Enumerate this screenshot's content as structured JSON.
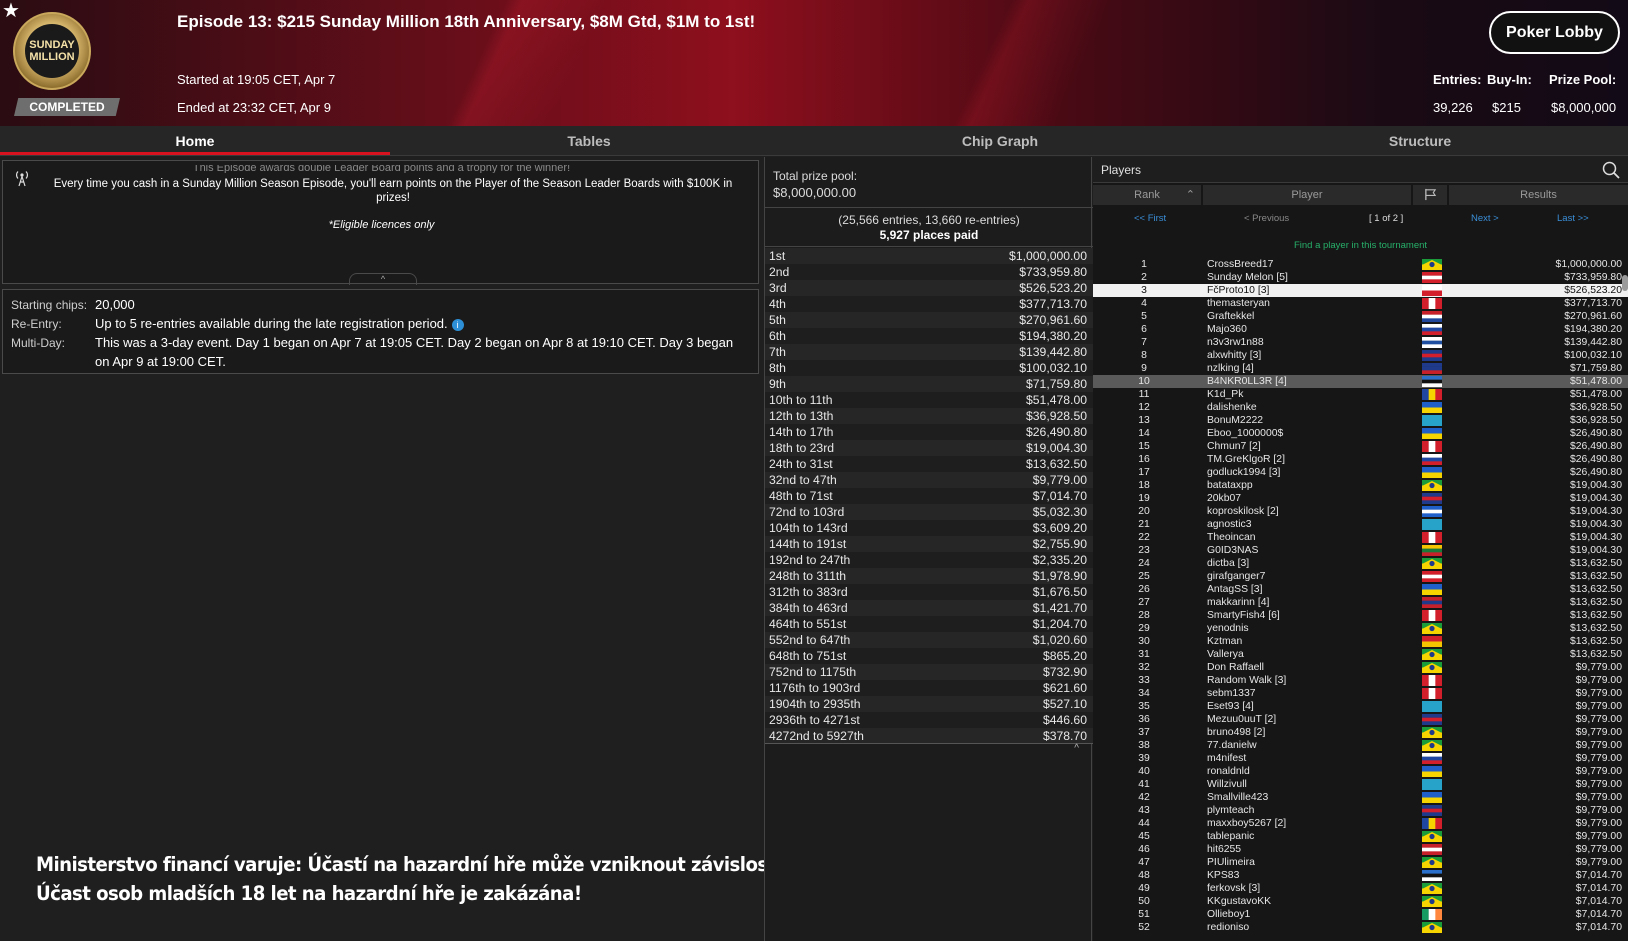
{
  "header": {
    "title": "Episode 13: $215 Sunday Million 18th Anniversary, $8M Gtd, $1M to 1st!",
    "started": "Started at 19:05 CET, Apr 7",
    "ended": "Ended at 23:32 CET, Apr 9",
    "status": "COMPLETED",
    "lobby_button": "Poker Lobby",
    "logo_text": "SUNDAY MILLION",
    "stats": {
      "entries_label": "Entries:",
      "entries": "39,226",
      "buyin_label": "Buy-In:",
      "buyin": "$215",
      "pool_label": "Prize Pool:",
      "pool": "$8,000,000"
    }
  },
  "tabs": [
    "Home",
    "Tables",
    "Chip Graph",
    "Structure"
  ],
  "message": {
    "cut_line": "This Episode awards double Leader Board points and a trophy for the winner!",
    "main": "Every time you cash in a Sunday Million Season Episode, you'll earn points on the Player of the Season Leader Boards with $100K in prizes!",
    "eligible": "*Eligible licences only"
  },
  "info": {
    "chips_label": "Starting chips:",
    "chips": "20,000",
    "reentry_label": "Re-Entry:",
    "reentry": "Up to 5 re-entries available during the late registration period.",
    "multiday_label": "Multi-Day:",
    "multiday": "This was a 3-day event. Day 1 began on Apr 7 at 19:05 CET. Day 2 began on Apr 8 at 19:10 CET. Day 3 began on Apr 9 at 19:00 CET."
  },
  "warning": {
    "line1": "Ministerstvo financí varuje: Účastí na hazardní hře může vzniknout závislost!",
    "line2": "Účast osob mladších 18 let na hazardní hře je zakázána!"
  },
  "prizes": {
    "pool_label": "Total prize pool:",
    "pool_value": "$8,000,000.00",
    "entries_info": "(25,566 entries, 13,660 re-entries)",
    "places_paid": "5,927 places paid",
    "rows": [
      {
        "place": "1st",
        "amount": "$1,000,000.00"
      },
      {
        "place": "2nd",
        "amount": "$733,959.80"
      },
      {
        "place": "3rd",
        "amount": "$526,523.20"
      },
      {
        "place": "4th",
        "amount": "$377,713.70"
      },
      {
        "place": "5th",
        "amount": "$270,961.60"
      },
      {
        "place": "6th",
        "amount": "$194,380.20"
      },
      {
        "place": "7th",
        "amount": "$139,442.80"
      },
      {
        "place": "8th",
        "amount": "$100,032.10"
      },
      {
        "place": "9th",
        "amount": "$71,759.80"
      },
      {
        "place": "10th to 11th",
        "amount": "$51,478.00"
      },
      {
        "place": "12th to 13th",
        "amount": "$36,928.50"
      },
      {
        "place": "14th to 17th",
        "amount": "$26,490.80"
      },
      {
        "place": "18th to 23rd",
        "amount": "$19,004.30"
      },
      {
        "place": "24th to 31st",
        "amount": "$13,632.50"
      },
      {
        "place": "32nd to 47th",
        "amount": "$9,779.00"
      },
      {
        "place": "48th to 71st",
        "amount": "$7,014.70"
      },
      {
        "place": "72nd to 103rd",
        "amount": "$5,032.30"
      },
      {
        "place": "104th to 143rd",
        "amount": "$3,609.20"
      },
      {
        "place": "144th to 191st",
        "amount": "$2,755.90"
      },
      {
        "place": "192nd to 247th",
        "amount": "$2,335.20"
      },
      {
        "place": "248th to 311th",
        "amount": "$1,978.90"
      },
      {
        "place": "312th to 383rd",
        "amount": "$1,676.50"
      },
      {
        "place": "384th to 463rd",
        "amount": "$1,421.70"
      },
      {
        "place": "464th to 551st",
        "amount": "$1,204.70"
      },
      {
        "place": "552nd to 647th",
        "amount": "$1,020.60"
      },
      {
        "place": "648th to 751st",
        "amount": "$865.20"
      },
      {
        "place": "752nd to 1175th",
        "amount": "$732.90"
      },
      {
        "place": "1176th to 1903rd",
        "amount": "$621.60"
      },
      {
        "place": "1904th to 2935th",
        "amount": "$527.10"
      },
      {
        "place": "2936th to 4271st",
        "amount": "$446.60"
      },
      {
        "place": "4272nd to 5927th",
        "amount": "$378.70"
      }
    ]
  },
  "players": {
    "title": "Players",
    "col_rank": "Rank",
    "col_player": "Player",
    "col_results": "Results",
    "pager": {
      "first": "<< First",
      "prev": "< Previous",
      "current": "[ 1 of 2 ]",
      "next": "Next >",
      "last": "Last >>"
    },
    "find": "Find a player in this tournament",
    "rows": [
      {
        "rank": "1",
        "name": "CrossBreed17",
        "flag": "br",
        "result": "$1,000,000.00"
      },
      {
        "rank": "2",
        "name": "Sunday Melon [5]",
        "flag": "at",
        "result": "$733,959.80"
      },
      {
        "rank": "3",
        "name": "FčProto10 [3]",
        "flag": "cz",
        "result": "$526,523.20"
      },
      {
        "rank": "4",
        "name": "themasteryan",
        "flag": "ca",
        "result": "$377,713.70"
      },
      {
        "rank": "5",
        "name": "Graftekkel",
        "flag": "nl",
        "result": "$270,961.60"
      },
      {
        "rank": "6",
        "name": "Majo360",
        "flag": "sk",
        "result": "$194,380.20"
      },
      {
        "rank": "7",
        "name": "n3v3rw1n88",
        "flag": "fi",
        "result": "$139,442.80"
      },
      {
        "rank": "8",
        "name": "alxwhitty [3]",
        "flag": "uk",
        "result": "$100,032.10"
      },
      {
        "rank": "9",
        "name": "nzlking [4]",
        "flag": "nz",
        "result": "$71,759.80"
      },
      {
        "rank": "10",
        "name": "B4NKR0LL3R [4]",
        "flag": "ee",
        "result": "$51,478.00"
      },
      {
        "rank": "11",
        "name": "K1d_Pk",
        "flag": "ro",
        "result": "$51,478.00"
      },
      {
        "rank": "12",
        "name": "dalishenke",
        "flag": "ua",
        "result": "$36,928.50"
      },
      {
        "rank": "13",
        "name": "BonuM2222",
        "flag": "kz",
        "result": "$36,928.50"
      },
      {
        "rank": "14",
        "name": "Eboo_1000000$",
        "flag": "ua",
        "result": "$26,490.80"
      },
      {
        "rank": "15",
        "name": "Chmun7 [2]",
        "flag": "pe",
        "result": "$26,490.80"
      },
      {
        "rank": "16",
        "name": "TM.GreKlgoR [2]",
        "flag": "ru",
        "result": "$26,490.80"
      },
      {
        "rank": "17",
        "name": "godluck1994 [3]",
        "flag": "ua",
        "result": "$26,490.80"
      },
      {
        "rank": "18",
        "name": "batataxpp",
        "flag": "br",
        "result": "$19,004.30"
      },
      {
        "rank": "19",
        "name": "20kb07",
        "flag": "uk",
        "result": "$19,004.30"
      },
      {
        "rank": "20",
        "name": "koproskilosk [2]",
        "flag": "gr",
        "result": "$19,004.30"
      },
      {
        "rank": "21",
        "name": "agnostic3",
        "flag": "kz",
        "result": "$19,004.30"
      },
      {
        "rank": "22",
        "name": "Theoincan",
        "flag": "ca",
        "result": "$19,004.30"
      },
      {
        "rank": "23",
        "name": "G0ID3NAS",
        "flag": "lt",
        "result": "$19,004.30"
      },
      {
        "rank": "24",
        "name": "dictba [3]",
        "flag": "br",
        "result": "$13,632.50"
      },
      {
        "rank": "25",
        "name": "girafganger7",
        "flag": "at",
        "result": "$13,632.50"
      },
      {
        "rank": "26",
        "name": "AntagSS [3]",
        "flag": "ua",
        "result": "$13,632.50"
      },
      {
        "rank": "27",
        "name": "makkarinn [4]",
        "flag": "no",
        "result": "$13,632.50"
      },
      {
        "rank": "28",
        "name": "SmartyFish4 [6]",
        "flag": "ca",
        "result": "$13,632.50"
      },
      {
        "rank": "29",
        "name": "yenodnis",
        "flag": "br",
        "result": "$13,632.50"
      },
      {
        "rank": "30",
        "name": "Kztman",
        "flag": "kg",
        "result": "$13,632.50"
      },
      {
        "rank": "31",
        "name": "Vallerya",
        "flag": "br",
        "result": "$13,632.50"
      },
      {
        "rank": "32",
        "name": "Don Raffaell",
        "flag": "br",
        "result": "$9,779.00"
      },
      {
        "rank": "33",
        "name": "Random Walk [3]",
        "flag": "pe",
        "result": "$9,779.00"
      },
      {
        "rank": "34",
        "name": "sebm1337",
        "flag": "pe",
        "result": "$9,779.00"
      },
      {
        "rank": "35",
        "name": "Eset93 [4]",
        "flag": "kz",
        "result": "$9,779.00"
      },
      {
        "rank": "36",
        "name": "Mezuu0uuT [2]",
        "flag": "uk",
        "result": "$9,779.00"
      },
      {
        "rank": "37",
        "name": "bruno498 [2]",
        "flag": "br",
        "result": "$9,779.00"
      },
      {
        "rank": "38",
        "name": "77.danielw",
        "flag": "br",
        "result": "$9,779.00"
      },
      {
        "rank": "39",
        "name": "m4nifest",
        "flag": "ru",
        "result": "$9,779.00"
      },
      {
        "rank": "40",
        "name": "ronaldnld",
        "flag": "ua",
        "result": "$9,779.00"
      },
      {
        "rank": "41",
        "name": "Willzivull",
        "flag": "kz",
        "result": "$9,779.00"
      },
      {
        "rank": "42",
        "name": "Smallville423",
        "flag": "ua",
        "result": "$9,779.00"
      },
      {
        "rank": "43",
        "name": "plymteach",
        "flag": "uk",
        "result": "$9,779.00"
      },
      {
        "rank": "44",
        "name": "maxxboy5267 [2]",
        "flag": "ro",
        "result": "$9,779.00"
      },
      {
        "rank": "45",
        "name": "tablepanic",
        "flag": "br",
        "result": "$9,779.00"
      },
      {
        "rank": "46",
        "name": "hit6255",
        "flag": "dk",
        "result": "$9,779.00"
      },
      {
        "rank": "47",
        "name": "PIUlimeira",
        "flag": "br",
        "result": "$9,779.00"
      },
      {
        "rank": "48",
        "name": "KPS83",
        "flag": "ee",
        "result": "$7,014.70"
      },
      {
        "rank": "49",
        "name": "ferkovsk [3]",
        "flag": "br",
        "result": "$7,014.70"
      },
      {
        "rank": "50",
        "name": "KKgustavoKK",
        "flag": "br",
        "result": "$7,014.70"
      },
      {
        "rank": "51",
        "name": "Ollieboy1",
        "flag": "ie",
        "result": "$7,014.70"
      },
      {
        "rank": "52",
        "name": "redioniso",
        "flag": "br",
        "result": "$7,014.70"
      }
    ]
  },
  "colors": {
    "accent": "#d9121f",
    "link": "#3a8ed8",
    "find": "#27b06a"
  }
}
